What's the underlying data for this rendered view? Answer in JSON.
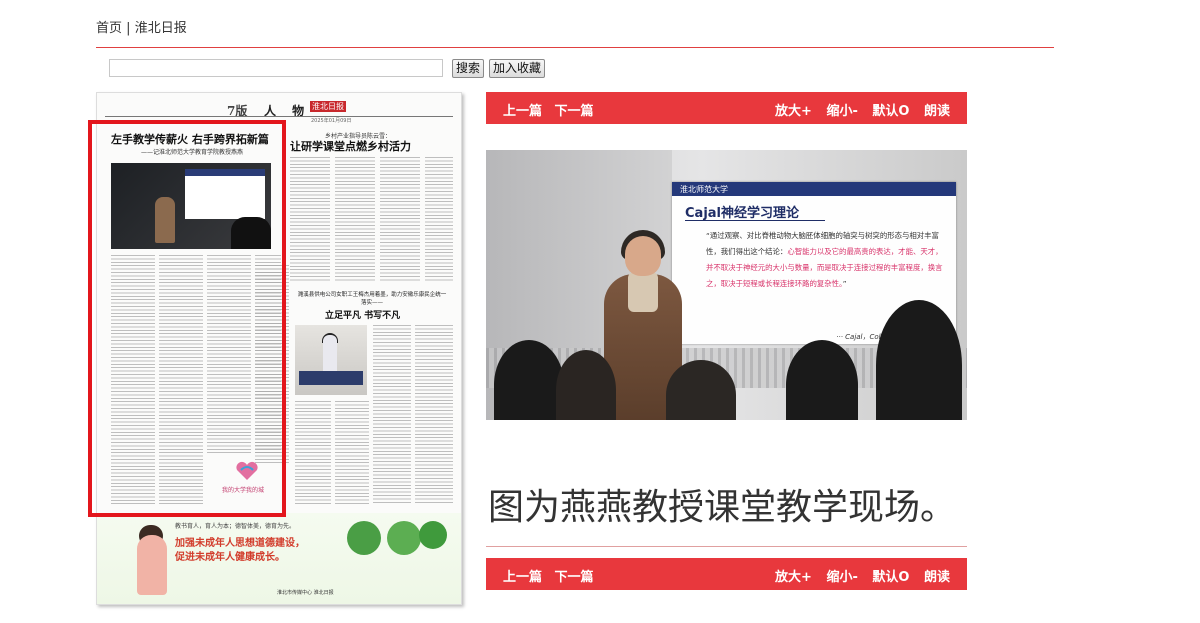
{
  "breadcrumb": {
    "home": "首页",
    "separator": "|",
    "current": "淮北日报"
  },
  "search": {
    "value": "",
    "placeholder": "",
    "button": "搜索",
    "favorite_button": "加入收藏"
  },
  "newspaper": {
    "page_number": "7版",
    "section": "人 物",
    "masthead": "淮北日报",
    "date": "2025年01月09日",
    "headline1": "左手教学传薪火  右手跨界拓新篇",
    "headline1_sub": "——记淮北师范大学教育学院教授燕燕",
    "headline2_pre": "乡村产业指导员陈云雪：",
    "headline2": "让研学课堂点燃乡村活力",
    "headline3_pre": "濉溪县供电公司女职工王梅杰用着墨，助力安徽乐康民企统一落实——",
    "headline3": "立足平凡  书写不凡",
    "logo_text": "我的大学我的城",
    "ad_line1": "教书育人，育人为本；德智体美，德育为先。",
    "ad_line2": "加强未成年人思想道德建设，",
    "ad_line3": "促进未成年人健康成长。",
    "ad_footer": "淮北市传媒中心  淮北日报"
  },
  "toolbar": {
    "prev": "上一篇",
    "next": "下一篇",
    "zoom_in": "放大+",
    "zoom_out": "缩小-",
    "default": "默认O",
    "read_aloud": "朗读"
  },
  "photo": {
    "screen_logo": "淮北师范大学",
    "slide_title": "Cajal神经学习理论",
    "quote_part1": "“通过观察、对比脊椎动物大脑胚体细胞的轴突与树突的形态与相对丰富性，我们得出这个结论：",
    "quote_highlight": "心智能力以及它的最高贵的表达，才能、天才，并不取决于神经元的大小与数量，而是取决于连接过程的丰富程度，换言之，取决于短程或长程连接环路的复杂性。",
    "quote_close": "”",
    "signature": "··· Cajal，Collections of My Life"
  },
  "caption": "图为燕燕教授课堂教学现场。",
  "colors": {
    "accent": "#e8383d",
    "highlight_box": "#e3161c",
    "slide_navy": "#24387a",
    "quote_pink": "#d8336a"
  }
}
